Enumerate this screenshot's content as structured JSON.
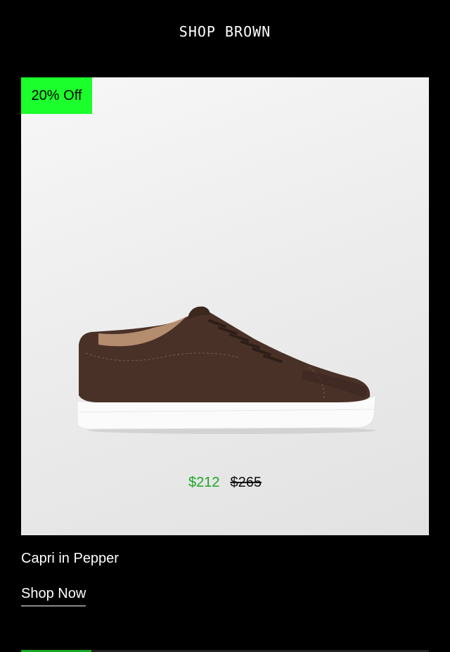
{
  "header": {
    "title": "SHOP BROWN"
  },
  "product": {
    "badge": "20% Off",
    "image_icon": "sneaker-image",
    "sale_price": "$212",
    "original_price": "$265",
    "name": "Capri in Pepper",
    "cta": "Shop Now"
  },
  "colors": {
    "background": "#000000",
    "badge": "#1bff2c",
    "sale_price": "#1aa623",
    "shoe_upper": "#4a3128",
    "sole": "#ffffff"
  }
}
